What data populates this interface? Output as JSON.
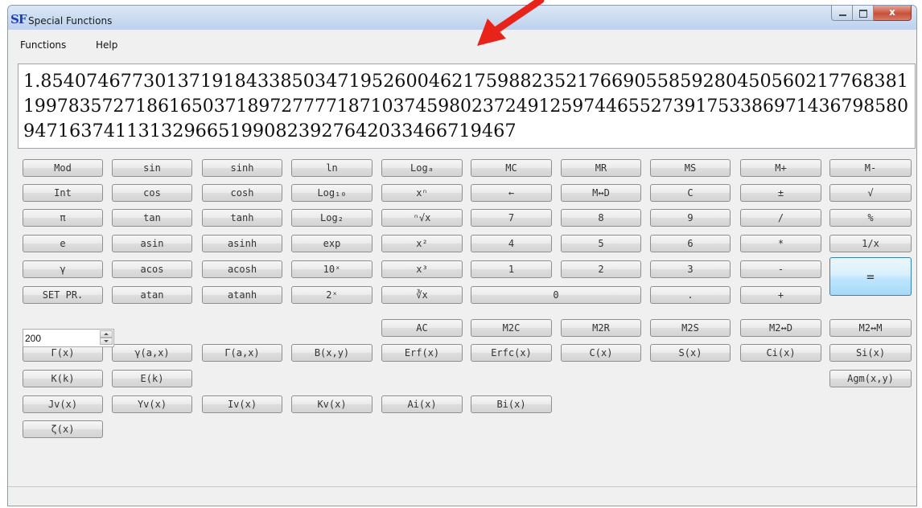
{
  "window": {
    "app_icon": "SF",
    "title": "Special Functions",
    "close_glyph": "x"
  },
  "menu": {
    "items": [
      "Functions",
      "Help"
    ]
  },
  "display": {
    "lines": [
      "1.8540746773013719184338503471952600462175988235217669055859280450560217768381",
      "1997835727186165037189727777187103745980237249125974465527391753386971436798580",
      "94716374113132966519908239276420334667194​67"
    ]
  },
  "precision": {
    "value": "200"
  },
  "arrow_color": "#e8241a",
  "accent_color": "#3c7fb1",
  "buttons": {
    "r1": [
      "Mod",
      "sin",
      "sinh",
      "ln",
      "Logₐ",
      "MC",
      "MR",
      "MS",
      "M+",
      "M-"
    ],
    "r2": [
      "Int",
      "cos",
      "cosh",
      "Log₁₀",
      "xⁿ",
      "←",
      "M↔D",
      "C",
      "±",
      "√"
    ],
    "r3": [
      "π",
      "tan",
      "tanh",
      "Log₂",
      "ⁿ√x",
      "7",
      "8",
      "9",
      "/",
      "%"
    ],
    "r4": [
      "e",
      "asin",
      "asinh",
      "exp",
      "x²",
      "4",
      "5",
      "6",
      "*",
      "1/x"
    ],
    "r5": [
      "γ",
      "acos",
      "acosh",
      "10ˣ",
      "x³",
      "1",
      "2",
      "3",
      "-"
    ],
    "r6": [
      "SET PR.",
      "atan",
      "atanh",
      "2ˣ",
      "∛x",
      "0",
      ".",
      "+"
    ],
    "equals": "=",
    "r7": [
      "AC",
      "M2C",
      "M2R",
      "M2S",
      "M2↔D",
      "M2↔M"
    ],
    "r8": [
      "Γ(x)",
      "γ(a,x)",
      "Γ(a,x)",
      "B(x,y)",
      "Erf(x)",
      "Erfc(x)",
      "C(x)",
      "S(x)",
      "Ci(x)",
      "Si(x)"
    ],
    "r9": [
      "K(k)",
      "E(k)",
      "Agm(x,y)"
    ],
    "r10": [
      "Jv(x)",
      "Yv(x)",
      "Iv(x)",
      "Kv(x)",
      "Ai(x)",
      "Bi(x)"
    ],
    "r11": [
      "ζ(x)"
    ]
  }
}
